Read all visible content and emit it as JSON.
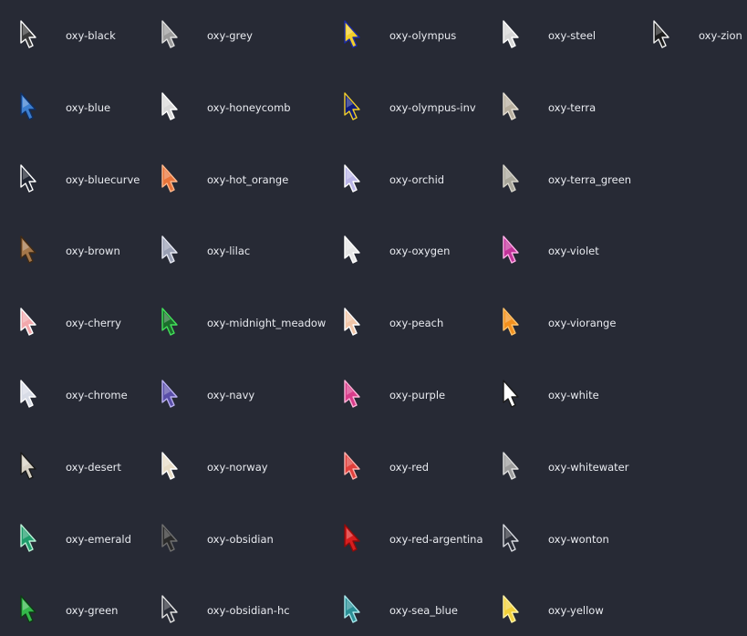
{
  "columns": [
    [
      {
        "name": "oxy-black",
        "fill": "#3a3a3a",
        "stroke": "#ffffff"
      },
      {
        "name": "oxy-blue",
        "fill": "#3d7fd0",
        "stroke": "#0f2f63"
      },
      {
        "name": "oxy-bluecurve",
        "fill": "#1f2431",
        "stroke": "#ffffff"
      },
      {
        "name": "oxy-brown",
        "fill": "#a4774a",
        "stroke": "#3f2a16"
      },
      {
        "name": "oxy-cherry",
        "fill": "#f2a8ac",
        "stroke": "#ffffff"
      },
      {
        "name": "oxy-chrome",
        "fill": "#d8dce6",
        "stroke": "#ffffff"
      },
      {
        "name": "oxy-desert",
        "fill": "#d6d0c3",
        "stroke": "#1a1a1a"
      },
      {
        "name": "oxy-emerald",
        "fill": "#1f9d6c",
        "stroke": "#b8f0d4"
      },
      {
        "name": "oxy-green",
        "fill": "#34b84a",
        "stroke": "#0f3b16"
      }
    ],
    [
      {
        "name": "oxy-grey",
        "fill": "#9b9b9b",
        "stroke": "#e0e0e0"
      },
      {
        "name": "oxy-honeycomb",
        "fill": "#d8d8d8",
        "stroke": "#ffffff"
      },
      {
        "name": "oxy-hot_orange",
        "fill": "#e8743a",
        "stroke": "#ffb88c"
      },
      {
        "name": "oxy-lilac",
        "fill": "#9aa0b4",
        "stroke": "#e6e8f2"
      },
      {
        "name": "oxy-midnight_meadow",
        "fill": "#1b6e2c",
        "stroke": "#43e05a"
      },
      {
        "name": "oxy-navy",
        "fill": "#5a4fa8",
        "stroke": "#b9b0f0"
      },
      {
        "name": "oxy-norway",
        "fill": "#e7dcc6",
        "stroke": "#ffffff"
      },
      {
        "name": "oxy-obsidian",
        "fill": "#2a2a2a",
        "stroke": "#6f6f6f"
      },
      {
        "name": "oxy-obsidian-hc",
        "fill": "#2b2e38",
        "stroke": "#e4e4e4"
      }
    ],
    [
      {
        "name": "oxy-olympus",
        "fill": "#f2cf2a",
        "stroke": "#1b2aa8"
      },
      {
        "name": "oxy-olympus-inv",
        "fill": "#0e1b7a",
        "stroke": "#f2cf2a"
      },
      {
        "name": "oxy-orchid",
        "fill": "#b9b4e6",
        "stroke": "#ffffff"
      },
      {
        "name": "oxy-oxygen",
        "fill": "#e6e6e6",
        "stroke": "#ffffff"
      },
      {
        "name": "oxy-peach",
        "fill": "#f2c6a8",
        "stroke": "#ffffff"
      },
      {
        "name": "oxy-purple",
        "fill": "#d83c8a",
        "stroke": "#ffb3d8"
      },
      {
        "name": "oxy-red",
        "fill": "#e0403c",
        "stroke": "#ffb0ad"
      },
      {
        "name": "oxy-red-argentina",
        "fill": "#d81e1e",
        "stroke": "#8a0c0c"
      },
      {
        "name": "oxy-sea_blue",
        "fill": "#2a8f96",
        "stroke": "#a8e8ec"
      }
    ],
    [
      {
        "name": "oxy-steel",
        "fill": "#d6d6d6",
        "stroke": "#ffffff"
      },
      {
        "name": "oxy-terra",
        "fill": "#b7ae9e",
        "stroke": "#e6e0d4"
      },
      {
        "name": "oxy-terra_green",
        "fill": "#a8a69a",
        "stroke": "#d8d6cc"
      },
      {
        "name": "oxy-violet",
        "fill": "#c2339a",
        "stroke": "#ffb0e8"
      },
      {
        "name": "oxy-viorange",
        "fill": "#f2901e",
        "stroke": "#ffc26a"
      },
      {
        "name": "oxy-white",
        "fill": "#ffffff",
        "stroke": "#1a1a1a"
      },
      {
        "name": "oxy-whitewater",
        "fill": "#9c9c9c",
        "stroke": "#e0e0e0"
      },
      {
        "name": "oxy-wonton",
        "fill": "#2b2e38",
        "stroke": "#d8dae0"
      },
      {
        "name": "oxy-yellow",
        "fill": "#f2d03a",
        "stroke": "#fff3a6"
      }
    ],
    [
      {
        "name": "oxy-zion",
        "fill": "#1c1c1c",
        "stroke": "#f2f2f2"
      }
    ]
  ]
}
